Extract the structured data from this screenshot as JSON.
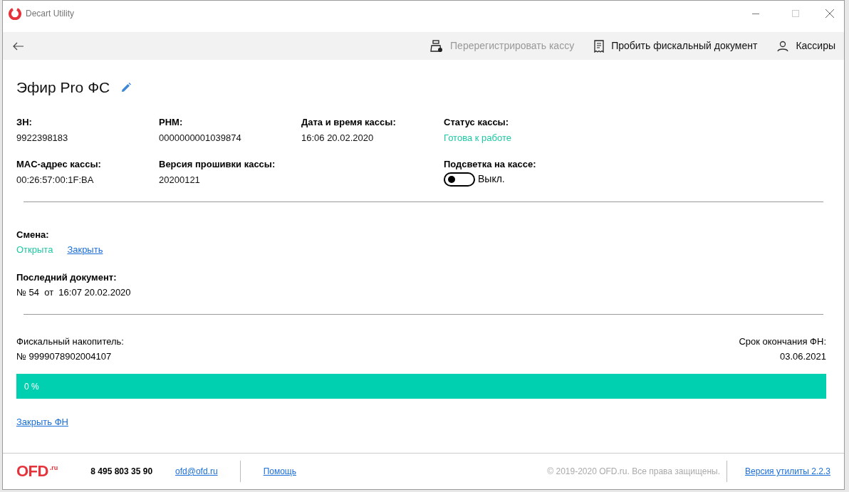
{
  "window": {
    "title": "Decart Utility"
  },
  "toolbar": {
    "actions": [
      {
        "kind": "register",
        "label": "Перерегистрировать кассу",
        "disabled": true
      },
      {
        "kind": "receipt",
        "label": "Пробить фискальный документ",
        "disabled": false
      },
      {
        "kind": "user",
        "label": "Кассиры",
        "disabled": false
      }
    ]
  },
  "device": {
    "name": "Эфир Pro ФС",
    "fields": [
      {
        "label": "ЗН:",
        "value": "9922398183",
        "kind": "text"
      },
      {
        "label": "РНМ:",
        "value": "0000000001039874",
        "kind": "text"
      },
      {
        "label": "Дата и время кассы:",
        "value": "16:06 20.02.2020",
        "kind": "text"
      },
      {
        "label": "Статус кассы:",
        "value": "Готова к работе",
        "kind": "status"
      },
      {
        "label": "MAC-адрес кассы:",
        "value": "00:26:57:00:1F:BA",
        "kind": "text"
      },
      {
        "label": "Версия прошивки кассы:",
        "value": "20200121",
        "kind": "text"
      },
      {
        "kind": "empty"
      },
      {
        "label": "Подсветка на кассе:",
        "value": "Выкл.",
        "kind": "toggle",
        "on": false
      }
    ]
  },
  "shift": {
    "label": "Смена:",
    "status": "Открыта",
    "action": "Закрыть"
  },
  "last_document": {
    "label": "Последний документ:",
    "value": "№ 54  от  16:07 20.02.2020"
  },
  "fiscal_storage": {
    "label": "Фискальный накопитель:",
    "number": "№ 9999078902004107",
    "expiry_label": "Срок окончания ФН:",
    "expiry": "03.06.2021",
    "level": 0,
    "reading": "0 %",
    "action": "Закрыть ФН"
  },
  "footer": {
    "logo": "OFD",
    "logo_suffix": ".ru",
    "phone": "8 495 803 35 90",
    "email": "ofd@ofd.ru",
    "help": "Помощь",
    "copyright": "© 2019-2020 OFD.ru. Все права защищены.",
    "version": "Версия утилиты 2.2.3"
  }
}
